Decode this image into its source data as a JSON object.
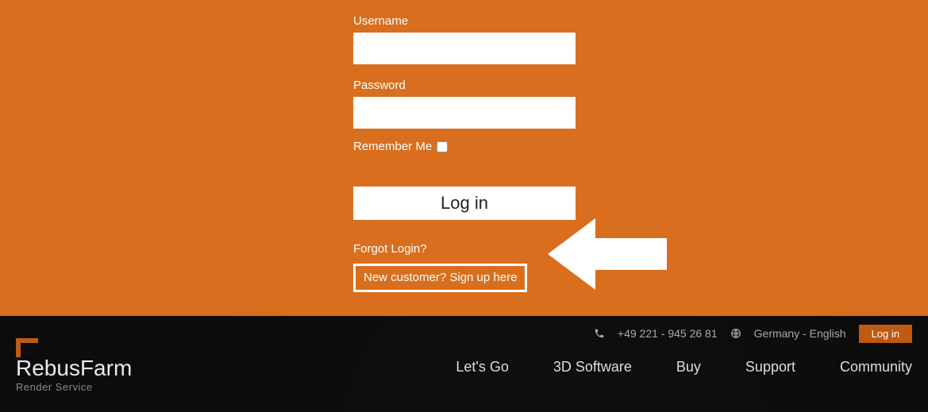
{
  "form": {
    "username_label": "Username",
    "username_value": "",
    "password_label": "Password",
    "password_value": "",
    "remember_label": "Remember Me",
    "login_button": "Log in",
    "forgot_label": "Forgot Login?",
    "signup_label": "New customer? Sign up here"
  },
  "topbar": {
    "phone": "+49 221 - 945 26 81",
    "language": "Germany - English",
    "login_button": "Log in"
  },
  "logo": {
    "brand_first": "Rebus",
    "brand_second": "Farm",
    "subtitle": "Render Service"
  },
  "nav": {
    "items": [
      "Let's Go",
      "3D Software",
      "Buy",
      "Support",
      "Community"
    ]
  },
  "colors": {
    "accent": "#d96f1e",
    "accent_dark": "#bf5a10"
  }
}
